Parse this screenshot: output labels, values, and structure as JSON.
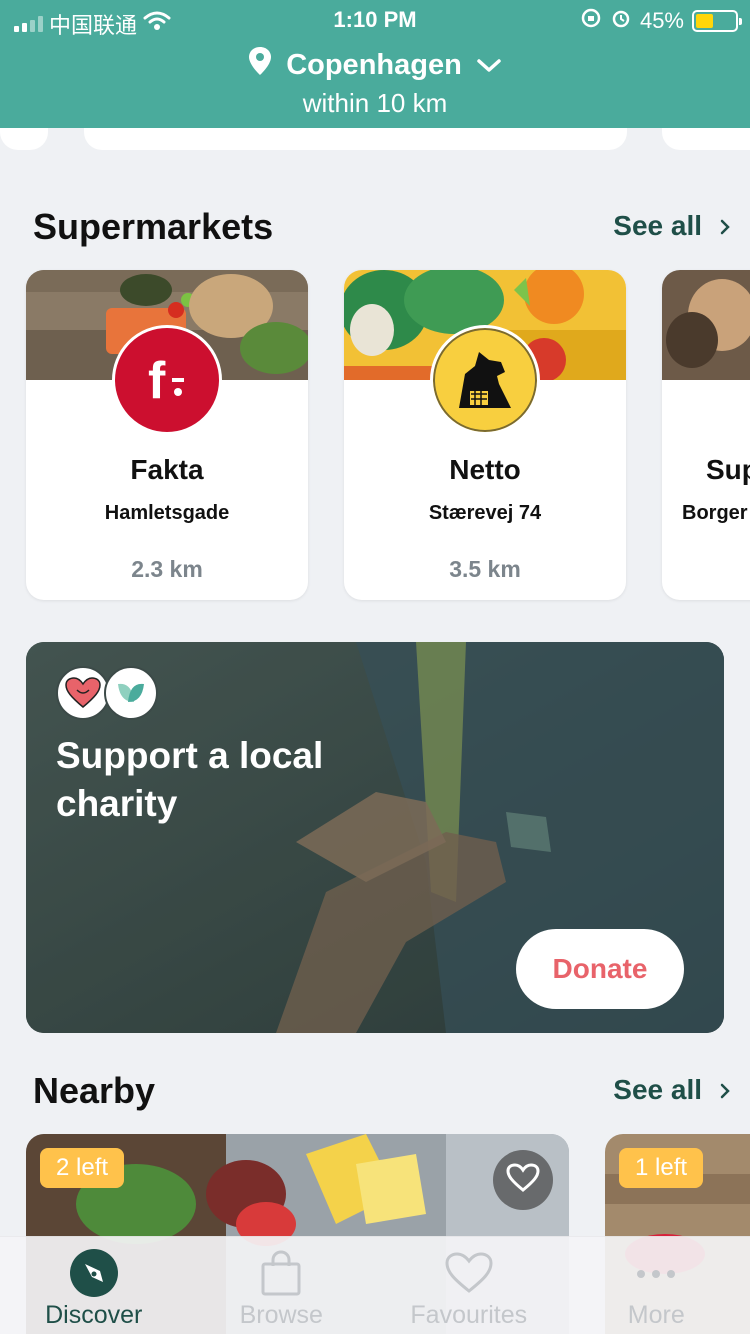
{
  "status_bar": {
    "carrier": "中国联通",
    "time": "1:10 PM",
    "battery": "45%",
    "battery_level": 0.45
  },
  "location": {
    "city": "Copenhagen",
    "radius": "within 10 km"
  },
  "supermarkets": {
    "title": "Supermarkets",
    "see_all": "See all",
    "stores": [
      {
        "name": "Fakta",
        "address": "Hamletsgade",
        "distance": "2.3 km"
      },
      {
        "name": "Netto",
        "address": "Stærevej 74",
        "distance": "3.5 km"
      },
      {
        "name": "Sup",
        "address": "Borger",
        "distance": ""
      }
    ]
  },
  "charity": {
    "title": "Support a local charity",
    "donate_label": "Donate"
  },
  "nearby": {
    "title": "Nearby",
    "see_all": "See all",
    "items": [
      {
        "badge": "2 left"
      },
      {
        "badge": "1 left"
      }
    ]
  },
  "tabs": [
    {
      "label": "Discover",
      "icon": "compass-icon",
      "active": true
    },
    {
      "label": "Browse",
      "icon": "bag-icon",
      "active": false
    },
    {
      "label": "Favourites",
      "icon": "heart-icon",
      "active": false
    },
    {
      "label": "More",
      "icon": "more-dots-icon",
      "active": false
    }
  ],
  "colors": {
    "header": "#4aab9c",
    "accent_dark": "#1f4f48",
    "fakta_red": "#cc0f2f",
    "netto_yellow": "#f8cf3f",
    "badge": "#ffc24b",
    "donate_text": "#e8636a"
  }
}
